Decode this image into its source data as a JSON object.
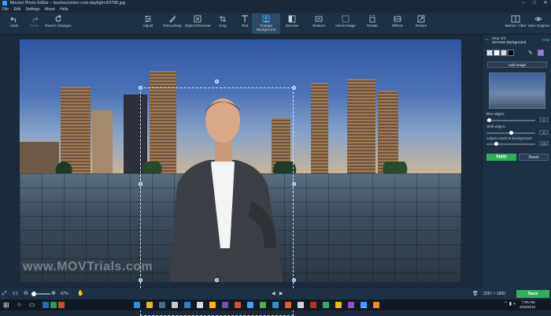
{
  "window": {
    "title": "Movavi Photo Editor – businessmen-cost-daylight-83798.jpg",
    "minimize": "–",
    "maximize": "□",
    "close": "✕"
  },
  "menu": [
    "File",
    "Edit",
    "Settings",
    "About",
    "Help"
  ],
  "toolbar": {
    "undo": "Undo",
    "redo": "Redo",
    "revert": "Revert Changes",
    "adjust": "Adjust",
    "retouching": "Retouching",
    "object_removal": "Object Removal",
    "crop": "Crop",
    "text": "Text",
    "change_background": "Change Background",
    "denoise": "Denoise",
    "restore": "Restore",
    "insert_image": "Insert Image",
    "rotate": "Rotate",
    "effects": "Effects",
    "resize": "Resize",
    "before_after": "Before / After",
    "view_original": "View Original"
  },
  "canvas": {
    "watermark": "www.MOVTrials.com"
  },
  "statusbar": {
    "fit": "1:1",
    "zoom": "47%",
    "dimensions": "3287 × 1800",
    "save": "Save"
  },
  "panel": {
    "step": "Step 3/3:",
    "step_title": "Set New Background",
    "help": "Help",
    "add_image": "Add Image",
    "blur_label": "Blur edges:",
    "blur_value": "1",
    "shift_label": "Shift edges:",
    "shift_value": "0",
    "adjust_label": "Adjust colors to background:",
    "adjust_value": "15",
    "apply": "Apply",
    "reset": "Reset",
    "swatches": [
      "#ffffff",
      "#dddddd",
      "#000000",
      "#9b7bdc"
    ]
  },
  "taskbar": {
    "time": "7:05 AM",
    "date": "3/28/2019"
  }
}
